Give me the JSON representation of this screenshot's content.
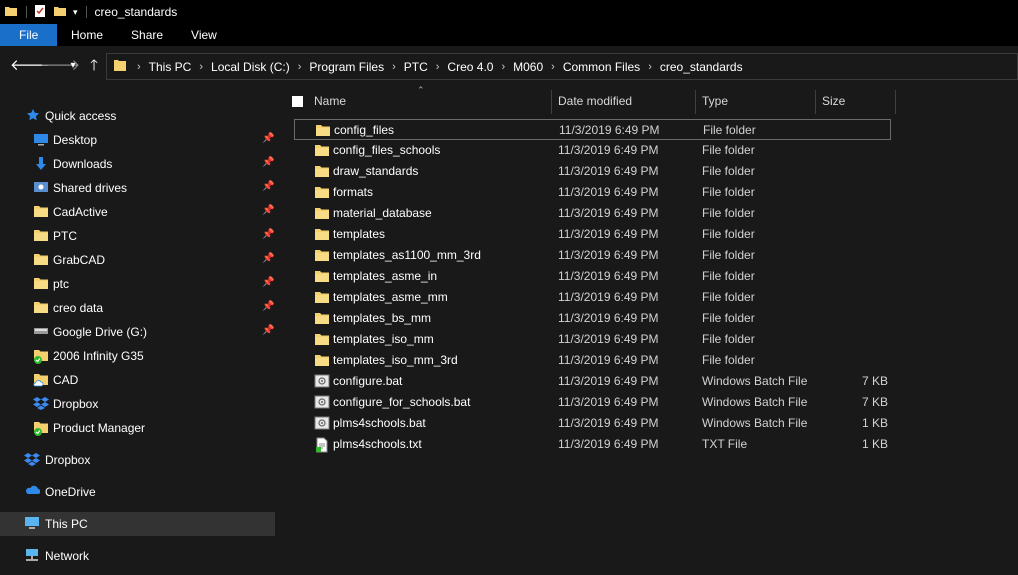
{
  "window": {
    "title": "creo_standards"
  },
  "ribbon": {
    "tabs": [
      "File",
      "Home",
      "Share",
      "View"
    ]
  },
  "address": {
    "crumbs": [
      "This PC",
      "Local Disk (C:)",
      "Program Files",
      "PTC",
      "Creo 4.0",
      "M060",
      "Common Files",
      "creo_standards"
    ]
  },
  "sidebar": {
    "quick_access": "Quick access",
    "pinned": [
      {
        "label": "Desktop",
        "icon": "desktop-icon"
      },
      {
        "label": "Downloads",
        "icon": "download-icon"
      },
      {
        "label": "Shared drives",
        "icon": "shared-drive-icon"
      },
      {
        "label": "CadActive",
        "icon": "folder-icon"
      },
      {
        "label": "PTC",
        "icon": "folder-icon"
      },
      {
        "label": "GrabCAD",
        "icon": "folder-icon"
      },
      {
        "label": "ptc",
        "icon": "folder-icon"
      },
      {
        "label": "creo data",
        "icon": "folder-icon"
      },
      {
        "label": "Google Drive (G:)",
        "icon": "drive-icon"
      },
      {
        "label": "2006 Infinity G35",
        "icon": "synced-folder-icon"
      },
      {
        "label": "CAD",
        "icon": "cloud-folder-icon"
      },
      {
        "label": "Dropbox",
        "icon": "dropbox-icon"
      },
      {
        "label": "Product Manager",
        "icon": "synced-folder-icon"
      }
    ],
    "roots": [
      {
        "label": "Dropbox",
        "icon": "dropbox-icon"
      },
      {
        "label": "OneDrive",
        "icon": "onedrive-icon"
      },
      {
        "label": "This PC",
        "icon": "computer-icon"
      },
      {
        "label": "Network",
        "icon": "network-icon"
      }
    ]
  },
  "columns": {
    "name": "Name",
    "date": "Date modified",
    "type": "Type",
    "size": "Size"
  },
  "files": [
    {
      "name": "config_files",
      "date": "11/3/2019 6:49 PM",
      "type": "File folder",
      "size": "",
      "icon": "folder-icon"
    },
    {
      "name": "config_files_schools",
      "date": "11/3/2019 6:49 PM",
      "type": "File folder",
      "size": "",
      "icon": "folder-icon"
    },
    {
      "name": "draw_standards",
      "date": "11/3/2019 6:49 PM",
      "type": "File folder",
      "size": "",
      "icon": "folder-icon"
    },
    {
      "name": "formats",
      "date": "11/3/2019 6:49 PM",
      "type": "File folder",
      "size": "",
      "icon": "folder-icon"
    },
    {
      "name": "material_database",
      "date": "11/3/2019 6:49 PM",
      "type": "File folder",
      "size": "",
      "icon": "folder-icon"
    },
    {
      "name": "templates",
      "date": "11/3/2019 6:49 PM",
      "type": "File folder",
      "size": "",
      "icon": "folder-icon"
    },
    {
      "name": "templates_as1100_mm_3rd",
      "date": "11/3/2019 6:49 PM",
      "type": "File folder",
      "size": "",
      "icon": "folder-icon"
    },
    {
      "name": "templates_asme_in",
      "date": "11/3/2019 6:49 PM",
      "type": "File folder",
      "size": "",
      "icon": "folder-icon"
    },
    {
      "name": "templates_asme_mm",
      "date": "11/3/2019 6:49 PM",
      "type": "File folder",
      "size": "",
      "icon": "folder-icon"
    },
    {
      "name": "templates_bs_mm",
      "date": "11/3/2019 6:49 PM",
      "type": "File folder",
      "size": "",
      "icon": "folder-icon"
    },
    {
      "name": "templates_iso_mm",
      "date": "11/3/2019 6:49 PM",
      "type": "File folder",
      "size": "",
      "icon": "folder-icon"
    },
    {
      "name": "templates_iso_mm_3rd",
      "date": "11/3/2019 6:49 PM",
      "type": "File folder",
      "size": "",
      "icon": "folder-icon"
    },
    {
      "name": "configure.bat",
      "date": "11/3/2019 6:49 PM",
      "type": "Windows Batch File",
      "size": "7 KB",
      "icon": "batch-file-icon"
    },
    {
      "name": "configure_for_schools.bat",
      "date": "11/3/2019 6:49 PM",
      "type": "Windows Batch File",
      "size": "7 KB",
      "icon": "batch-file-icon"
    },
    {
      "name": "plms4schools.bat",
      "date": "11/3/2019 6:49 PM",
      "type": "Windows Batch File",
      "size": "1 KB",
      "icon": "batch-file-icon"
    },
    {
      "name": "plms4schools.txt",
      "date": "11/3/2019 6:49 PM",
      "type": "TXT File",
      "size": "1 KB",
      "icon": "text-file-icon"
    }
  ],
  "colors": {
    "accent": "#1a6fc8",
    "folder": "#f4d06f",
    "background": "#191919"
  }
}
